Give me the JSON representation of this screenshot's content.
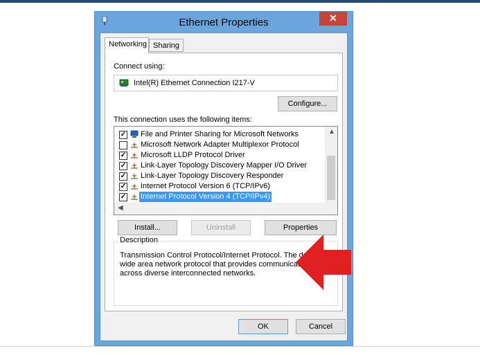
{
  "window": {
    "title": "Ethernet Properties",
    "close_glyph": "✕"
  },
  "tabs": [
    {
      "label": "Networking",
      "active": true
    },
    {
      "label": "Sharing",
      "active": false
    }
  ],
  "connect_using": {
    "label": "Connect using:",
    "adapter": "Intel(R) Ethernet Connection I217-V"
  },
  "buttons": {
    "configure": "Configure...",
    "install": "Install...",
    "uninstall": "Uninstall",
    "properties": "Properties",
    "ok": "OK",
    "cancel": "Cancel"
  },
  "items_label": "This connection uses the following items:",
  "items": [
    {
      "label": "File and Printer Sharing for Microsoft Networks",
      "checked": true,
      "icon": "network-computer-icon"
    },
    {
      "label": "Microsoft Network Adapter Multiplexor Protocol",
      "checked": false,
      "icon": "protocol-icon"
    },
    {
      "label": "Microsoft LLDP Protocol Driver",
      "checked": true,
      "icon": "protocol-icon"
    },
    {
      "label": "Link-Layer Topology Discovery Mapper I/O Driver",
      "checked": true,
      "icon": "protocol-icon"
    },
    {
      "label": "Link-Layer Topology Discovery Responder",
      "checked": true,
      "icon": "protocol-icon"
    },
    {
      "label": "Internet Protocol Version 6 (TCP/IPv6)",
      "checked": true,
      "icon": "protocol-icon"
    },
    {
      "label": "Internet Protocol Version 4 (TCP/IPv4)",
      "checked": true,
      "icon": "protocol-icon",
      "selected": true
    }
  ],
  "description": {
    "legend": "Description",
    "text": "Transmission Control Protocol/Internet Protocol. The default wide area network protocol that provides communication across diverse interconnected networks."
  },
  "colors": {
    "title_bar": "#6aa6dc",
    "close_button": "#c7443b",
    "selection": "#3399ff",
    "annotation_arrow": "#e02020"
  }
}
